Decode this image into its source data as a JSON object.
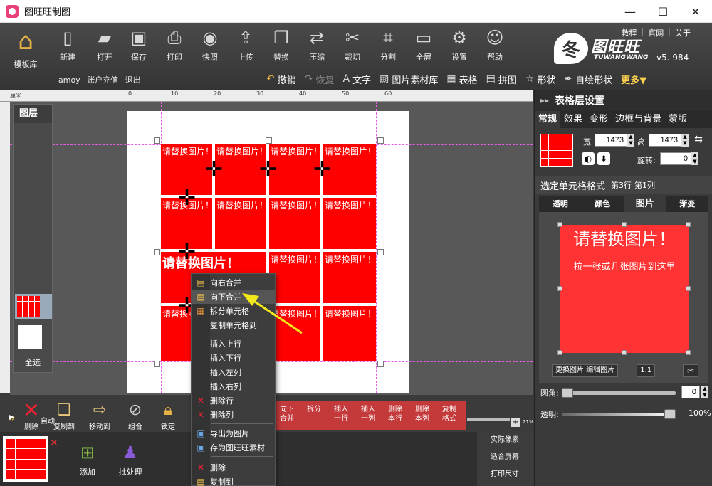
{
  "window": {
    "title": "图旺旺制图",
    "controls": {
      "minimize": "—",
      "maximize": "☐",
      "close": "✕"
    }
  },
  "toolbar": {
    "home": "模板库",
    "buttons": [
      {
        "label": "新建",
        "icon": "file-icon",
        "glyph": "▯"
      },
      {
        "label": "打开",
        "icon": "folder-icon",
        "glyph": "▰"
      },
      {
        "label": "保存",
        "icon": "save-icon",
        "glyph": "▣"
      },
      {
        "label": "打印",
        "icon": "printer-icon",
        "glyph": "⎙"
      },
      {
        "label": "快照",
        "icon": "camera-icon",
        "glyph": "◉"
      },
      {
        "label": "上传",
        "icon": "upload-icon",
        "glyph": "⇪"
      },
      {
        "label": "替换",
        "icon": "replace-icon",
        "glyph": "❐"
      },
      {
        "label": "压缩",
        "icon": "compress-icon",
        "glyph": "⇄"
      },
      {
        "label": "裁切",
        "icon": "scissors-icon",
        "glyph": "✂"
      },
      {
        "label": "分割",
        "icon": "crop-icon",
        "glyph": "⌗"
      },
      {
        "label": "全屏",
        "icon": "monitor-icon",
        "glyph": "▭"
      },
      {
        "label": "设置",
        "icon": "gear-icon",
        "glyph": "⚙"
      },
      {
        "label": "帮助",
        "icon": "qq-icon",
        "glyph": "☺"
      }
    ],
    "account": {
      "user": "amoy",
      "recharge": "账户充值",
      "logout": "退出"
    },
    "links": {
      "tutorial": "教程",
      "site": "官网",
      "about": "关于"
    },
    "logo": {
      "cn": "图旺旺",
      "en": "TUWANGWANG",
      "mark": "冬"
    },
    "version": "v5. 984",
    "tools": {
      "undo": "撤销",
      "redo": "恢复",
      "text": "文字",
      "image_lib": "图片素材库",
      "table": "表格",
      "collage": "拼图",
      "shape": "形状",
      "custom_shape": "自绘形状",
      "more": "更多▼"
    }
  },
  "ruler": {
    "unit": "厘米",
    "marks": [
      "0",
      "10",
      "20",
      "30",
      "40",
      "50",
      "60"
    ]
  },
  "canvas": {
    "placeholder": "请替换图片！",
    "big_placeholder": "请替换图片！"
  },
  "layers": {
    "title": "图层",
    "select_all": "全选"
  },
  "bottom_tools": {
    "delete": "删除",
    "copy_to": "复制到",
    "move_to": "移动到",
    "group": "组合",
    "lock": "锁定",
    "play": "▶",
    "auto": "自动"
  },
  "table_tools": [
    {
      "l1": "向下",
      "l2": "合并"
    },
    {
      "l1": "拆分",
      "l2": ""
    },
    {
      "l1": "插入",
      "l2": "一行"
    },
    {
      "l1": "插入",
      "l2": "一列"
    },
    {
      "l1": "删除",
      "l2": "本行"
    },
    {
      "l1": "删除",
      "l2": "本列"
    },
    {
      "l1": "复制",
      "l2": "格式"
    }
  ],
  "zoom": {
    "value": "21%",
    "plus": "+"
  },
  "thumbs": {
    "add": "添加",
    "batch": "批处理",
    "close": "✕"
  },
  "side_links": {
    "actual": "实际像素",
    "fit": "适合屏幕",
    "print": "打印尺寸"
  },
  "context_menu": {
    "items": [
      "向右合并",
      "向下合并",
      "拆分单元格",
      "复制单元格到",
      "插入上行",
      "插入下行",
      "插入左列",
      "插入右列",
      "删除行",
      "删除列",
      "导出为图片",
      "存为图旺旺素材",
      "删除",
      "复制到"
    ]
  },
  "right_panel": {
    "title": "表格层设置",
    "tabs": [
      "常规",
      "效果",
      "变形",
      "框与背景",
      "蒙版"
    ],
    "border_prefix": "边",
    "width_label": "宽",
    "width": "1473",
    "height_label": "高",
    "height": "1473",
    "rotate_label": "旋转:",
    "rotate": "0",
    "cell_format": "选定单元格格式",
    "row": "第3行",
    "col": "第1列",
    "sub_tabs": [
      "透明",
      "颜色",
      "图片",
      "渐变"
    ],
    "image_title": "请替换图片！",
    "image_hint": "拉一张或几张图片到这里",
    "replace_btn": "更换图片",
    "edit_btn": "编辑图片",
    "ratio": "1:1",
    "radius_label": "圆角:",
    "radius": "0",
    "opacity_label": "透明:",
    "opacity": "100%",
    "opacity_level": 1.0
  },
  "colors": {
    "accent_red": "#ff0000",
    "strip_red": "#c43a3a",
    "highlight": "#ffd34d"
  }
}
